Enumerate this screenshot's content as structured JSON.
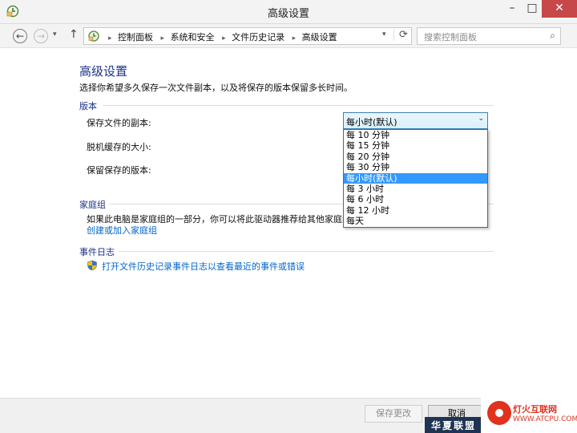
{
  "window": {
    "title": "高级设置",
    "minimize": "–",
    "maximize": "□",
    "close": "✕"
  },
  "nav": {
    "back": "←",
    "forward": "→",
    "recent": "▾",
    "up": "↑"
  },
  "address": {
    "crumbs": [
      "控制面板",
      "系统和安全",
      "文件历史记录",
      "高级设置"
    ],
    "separator": "▸",
    "dropdown": "▾",
    "refresh": "⟳"
  },
  "search": {
    "placeholder": "搜索控制面板",
    "icon": "⌕"
  },
  "page": {
    "title": "高级设置",
    "description": "选择你希望多久保存一次文件副本，以及将保存的版本保留多长时间。"
  },
  "versions": {
    "heading": "版本",
    "save_copies_label": "保存文件的副本:",
    "offline_cache_label": "脱机缓存的大小:",
    "keep_versions_label": "保留保存的版本:",
    "frequency": {
      "selected": "每小时(默认)",
      "arrow": "⌄",
      "options": [
        "每 10 分钟",
        "每 15 分钟",
        "每 20 分钟",
        "每 30 分钟",
        "每小时(默认)",
        "每 3 小时",
        "每 6 小时",
        "每 12 小时",
        "每天"
      ],
      "highlighted_index": 4
    }
  },
  "homegroup": {
    "heading": "家庭组",
    "text": "如果此电脑是家庭组的一部分，你可以将此驱动器推荐给其他家庭组",
    "link": "创建或加入家庭组"
  },
  "event_log": {
    "heading": "事件日志",
    "link": "打开文件历史记录事件日志以查看最近的事件或错误"
  },
  "footer": {
    "save": "保存更改",
    "cancel": "取消"
  },
  "watermark": {
    "left_text": "华夏联盟",
    "name": "灯火互联网",
    "url": "WWW.ATCPU.COM"
  },
  "colors": {
    "heading": "#1e3287",
    "link": "#0066cc",
    "selection": "#3399ff",
    "close_button": "#c74848"
  }
}
